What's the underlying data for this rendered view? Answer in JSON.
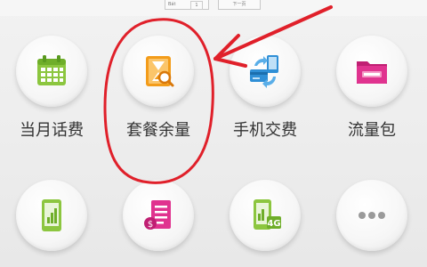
{
  "top": {
    "input_label": "Bát",
    "input_value": "1",
    "button_label": "下一页"
  },
  "tiles": [
    {
      "label": "当月话费",
      "icon": "calendar-icon"
    },
    {
      "label": "套餐余量",
      "icon": "hourglass-search-icon"
    },
    {
      "label": "手机交费",
      "icon": "phone-payment-exchange-icon"
    },
    {
      "label": "流量包",
      "icon": "data-package-folder-icon"
    },
    {
      "label": "",
      "icon": "phone-signal-icon"
    },
    {
      "label": "",
      "icon": "bill-document-icon"
    },
    {
      "label": "",
      "icon": "4g-phone-icon"
    },
    {
      "label": "",
      "icon": "more-icon"
    }
  ],
  "colors": {
    "annotation": "#e0202a",
    "green": "#8cc63f",
    "orange": "#f39c1a",
    "blue": "#2f8fd6",
    "pink": "#e0338f"
  }
}
